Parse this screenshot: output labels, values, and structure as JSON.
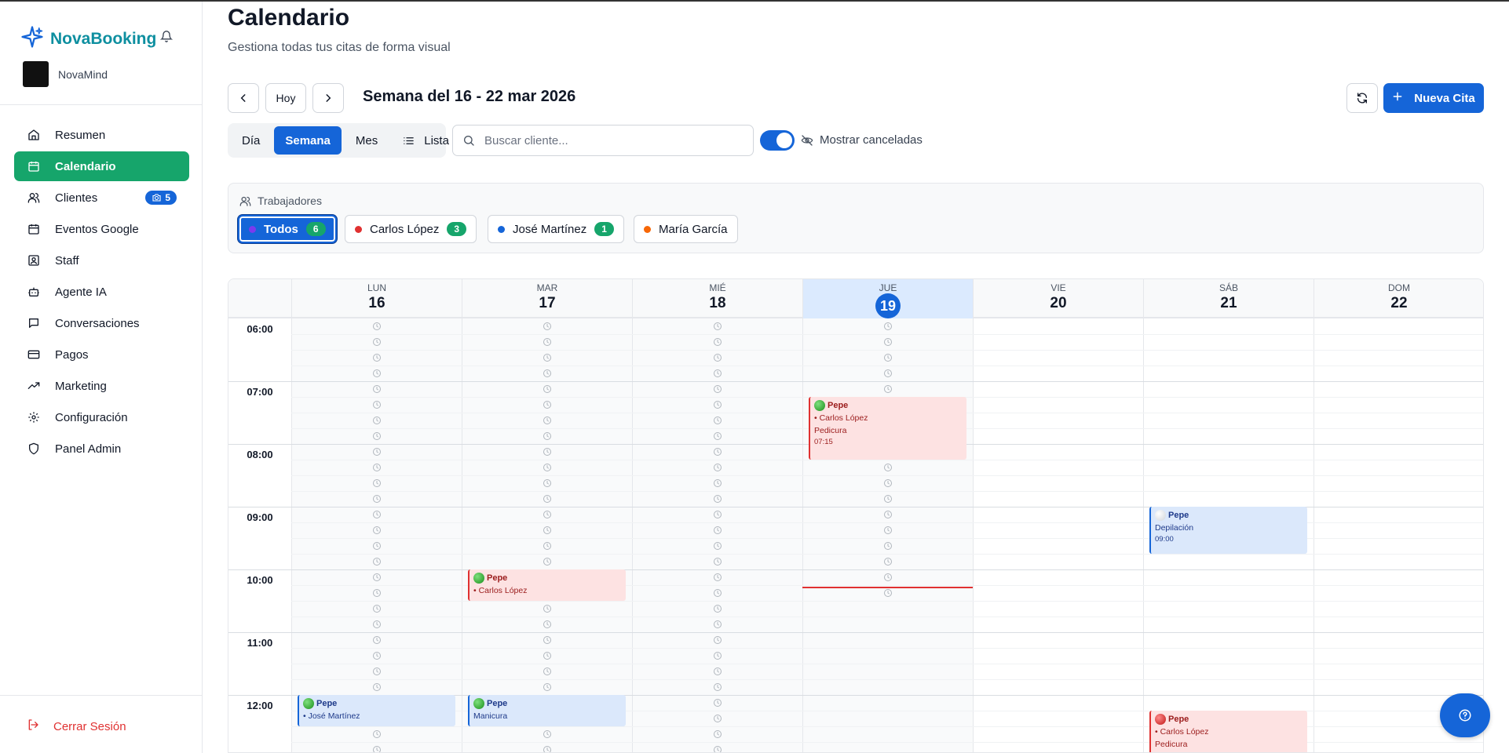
{
  "app": {
    "name": "NovaBooking",
    "org": "NovaMind",
    "brand_color": "#0e8fa0",
    "accent": "#1565d8",
    "success": "#16a56b"
  },
  "sidebar": {
    "items": [
      {
        "label": "Resumen",
        "icon": "home-icon"
      },
      {
        "label": "Calendario",
        "icon": "calendar-icon",
        "active": true
      },
      {
        "label": "Clientes",
        "icon": "users-icon",
        "badge": "5"
      },
      {
        "label": "Eventos Google",
        "icon": "calendar-grid-icon"
      },
      {
        "label": "Staff",
        "icon": "id-card-icon"
      },
      {
        "label": "Agente IA",
        "icon": "bot-icon"
      },
      {
        "label": "Conversaciones",
        "icon": "chat-icon"
      },
      {
        "label": "Pagos",
        "icon": "credit-card-icon"
      },
      {
        "label": "Marketing",
        "icon": "trending-icon"
      },
      {
        "label": "Configuración",
        "icon": "gear-icon"
      },
      {
        "label": "Panel Admin",
        "icon": "shield-icon"
      }
    ],
    "logout": "Cerrar Sesión"
  },
  "header": {
    "title": "Calendario",
    "subtitle": "Gestiona todas tus citas de forma visual"
  },
  "toolbar": {
    "today": "Hoy",
    "week_label": "Semana del 16 - 22 mar 2026",
    "new_label": "Nueva Cita"
  },
  "views": [
    "Día",
    "Semana",
    "Mes",
    "Lista"
  ],
  "active_view": "Semana",
  "search": {
    "placeholder": "Buscar cliente...",
    "value": ""
  },
  "show_cancelled": {
    "label": "Mostrar canceladas",
    "on": true
  },
  "workers": {
    "title": "Trabajadores",
    "chips": [
      {
        "label": "Todos",
        "count": "6",
        "color": "#7c3aed",
        "active": true
      },
      {
        "label": "Carlos López",
        "count": "3",
        "color": "#e03131"
      },
      {
        "label": "José Martínez",
        "count": "1",
        "color": "#1565d8"
      },
      {
        "label": "María García",
        "count": "",
        "color": "#f76707"
      }
    ]
  },
  "calendar": {
    "days": [
      {
        "name": "LUN",
        "num": "16"
      },
      {
        "name": "MAR",
        "num": "17"
      },
      {
        "name": "MIÉ",
        "num": "18"
      },
      {
        "name": "JUE",
        "num": "19",
        "today": true
      },
      {
        "name": "VIE",
        "num": "20"
      },
      {
        "name": "SÁB",
        "num": "21"
      },
      {
        "name": "DOM",
        "num": "22"
      }
    ],
    "hours": [
      "06:00",
      "07:00",
      "08:00",
      "09:00",
      "10:00",
      "11:00",
      "12:00"
    ],
    "events": [
      {
        "day": 3,
        "start": "07:15",
        "end": "08:15",
        "color": "red",
        "status": "green",
        "client": "Pepe",
        "worker": "Carlos López",
        "service": "Pedicura",
        "time": "07:15"
      },
      {
        "day": 5,
        "start": "09:00",
        "end": "09:45",
        "color": "blue",
        "status": "gray",
        "client": "Pepe",
        "worker": "",
        "service": "Depilación",
        "time": "09:00"
      },
      {
        "day": 1,
        "start": "10:00",
        "end": "10:30",
        "color": "red",
        "status": "green",
        "client": "Pepe",
        "worker": "Carlos López",
        "service": "",
        "time": ""
      },
      {
        "day": 0,
        "start": "12:00",
        "end": "12:30",
        "color": "blue",
        "status": "green",
        "client": "Pepe",
        "worker": "José Martínez",
        "service": "",
        "time": ""
      },
      {
        "day": 1,
        "start": "12:00",
        "end": "12:30",
        "color": "blue",
        "status": "green",
        "client": "Pepe",
        "worker": "",
        "service": "Manicura",
        "time": ""
      },
      {
        "day": 5,
        "start": "12:15",
        "end": "13:15",
        "color": "red",
        "status": "red",
        "client": "Pepe",
        "worker": "Carlos López",
        "service": "Pedicura",
        "time": ""
      }
    ]
  }
}
